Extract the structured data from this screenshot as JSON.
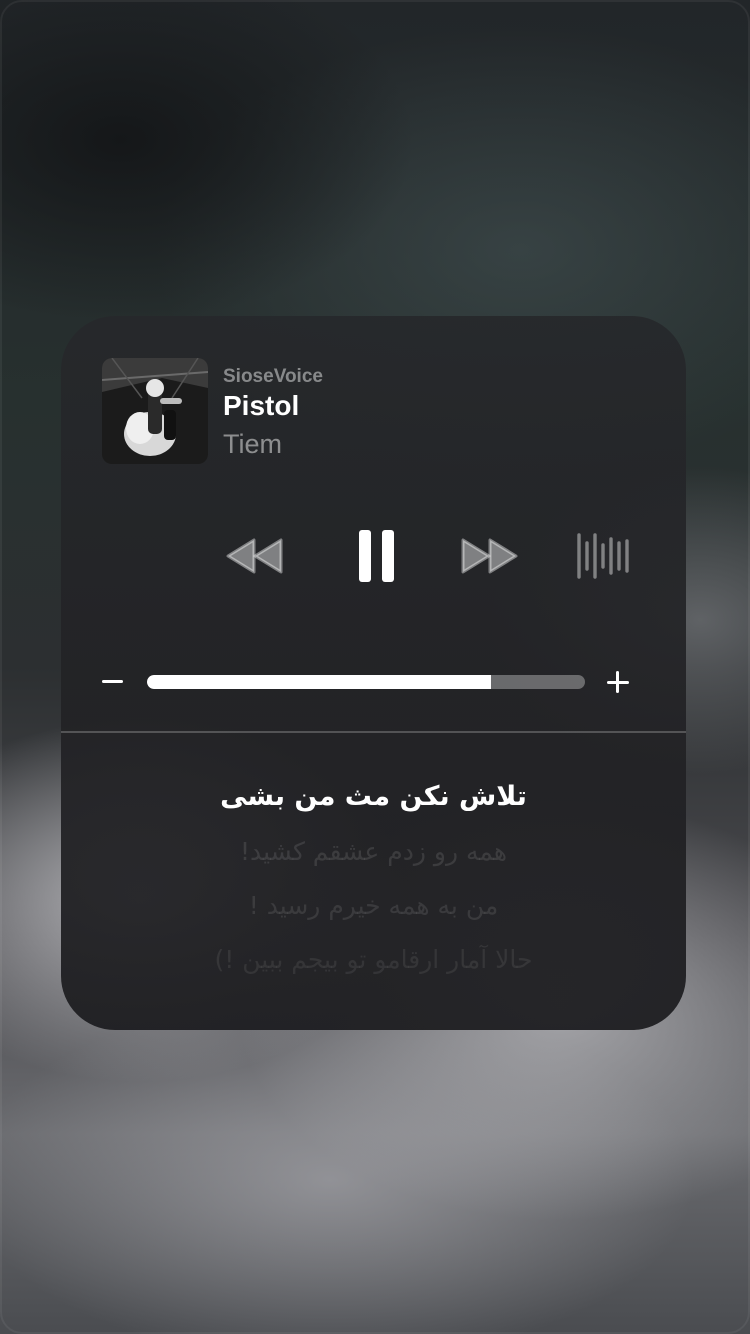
{
  "now_playing": {
    "source": "SioseVoice",
    "title": "Pistol",
    "artist": "Tiem"
  },
  "controls": {
    "rewind_icon": "rewind-icon",
    "pause_icon": "pause-icon",
    "forward_icon": "fast-forward-icon",
    "output_icon": "audio-output-icon"
  },
  "volume": {
    "minus_label": "–",
    "plus_label": "+",
    "level_fraction": 0.785
  },
  "lyrics": {
    "lines": [
      "تلاش نکن مث من بشی",
      "همه رو زدم عشقم کشید!",
      "من به همه خیرم رسید !",
      "حالا آمار ارقامو تو بیجم ببین !)"
    ]
  },
  "colors": {
    "card_bg": "#242528",
    "text_primary": "#ffffff",
    "accent_fill": "#ffffff"
  }
}
